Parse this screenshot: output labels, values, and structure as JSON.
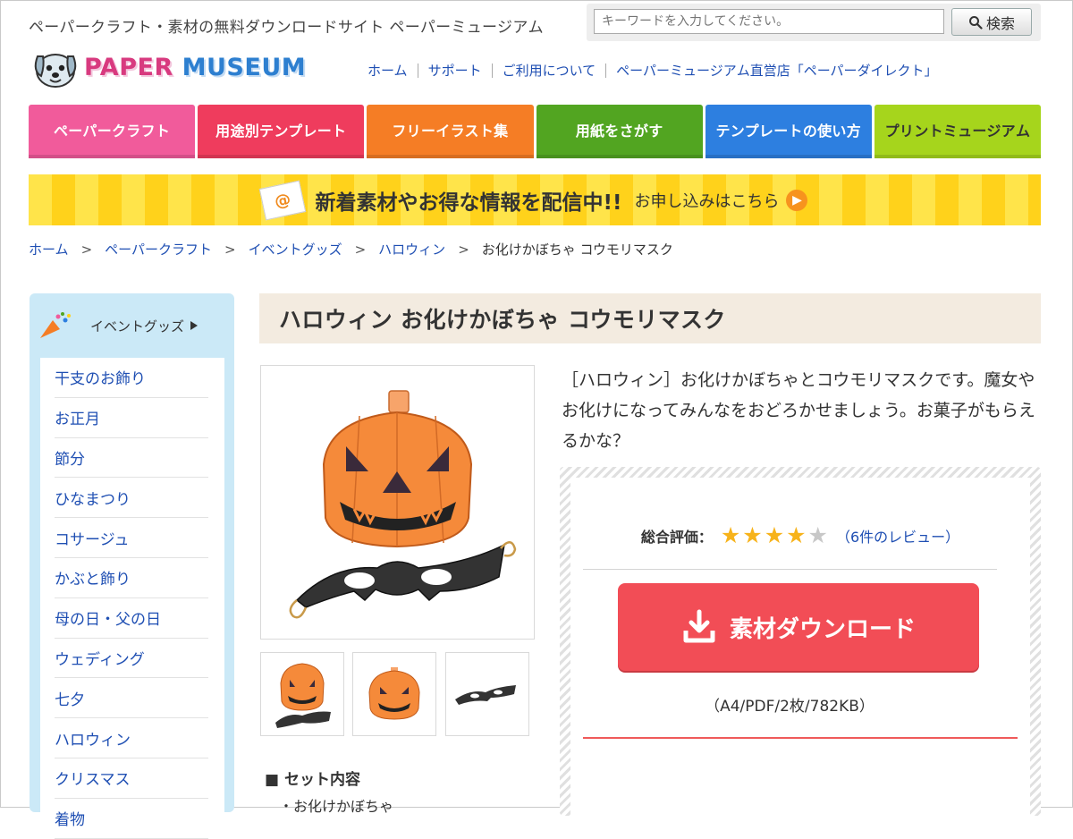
{
  "header": {
    "tagline": "ペーパークラフト・素材の無料ダウンロードサイト ペーパーミュージアム",
    "search_placeholder": "キーワードを入力してください。",
    "search_button": "検索",
    "logo_text_1": "PAPER",
    "logo_text_2": "MUSEUM",
    "nav": [
      "ホーム",
      "サポート",
      "ご利用について",
      "ペーパーミュージアム直営店「ペーパーダイレクト」"
    ]
  },
  "categories": [
    {
      "label": "ペーパークラフト",
      "color": "#f15b9b"
    },
    {
      "label": "用途別テンプレート",
      "color": "#ef3c5d"
    },
    {
      "label": "フリーイラスト集",
      "color": "#f57d25"
    },
    {
      "label": "用紙をさがす",
      "color": "#52a521"
    },
    {
      "label": "テンプレートの使い方",
      "color": "#2d7fe0"
    },
    {
      "label": "プリントミュージアム",
      "color": "#a6d51c"
    }
  ],
  "banner": {
    "main": "新着素材やお得な情報を配信中!!",
    "sub": "お申し込みはこちら"
  },
  "breadcrumb": {
    "items": [
      "ホーム",
      "ペーパークラフト",
      "イベントグッズ",
      "ハロウィン"
    ],
    "current": "お化けかぼちゃ コウモリマスク"
  },
  "sidebar": {
    "heading": "イベントグッズ",
    "items": [
      "干支のお飾り",
      "お正月",
      "節分",
      "ひなまつり",
      "コサージュ",
      "かぶと飾り",
      "母の日・父の日",
      "ウェディング",
      "七夕",
      "ハロウィン",
      "クリスマス",
      "着物"
    ]
  },
  "product": {
    "title": "ハロウィン お化けかぼちゃ コウモリマスク",
    "description": "［ハロウィン］お化けかぼちゃとコウモリマスクです。魔女やお化けになってみんなをおどろかせましょう。お菓子がもらえるかな？",
    "rating_label": "総合評価：",
    "rating_value": 4,
    "rating_max": 5,
    "review_link": "（6件のレビュー）",
    "download_label": "素材ダウンロード",
    "file_info": "（A4/PDF/2枚/782KB）",
    "set_title": "■ セット内容",
    "set_items": [
      "・お化けかぼちゃ"
    ]
  },
  "colors": {
    "accent_link": "#1f4fb3",
    "download_button": "#f24d56",
    "star_on": "#f7b31b",
    "star_off": "#c8c8c8",
    "sidebar_bg": "#cbe9f7",
    "title_bg": "#f3ebe0"
  }
}
